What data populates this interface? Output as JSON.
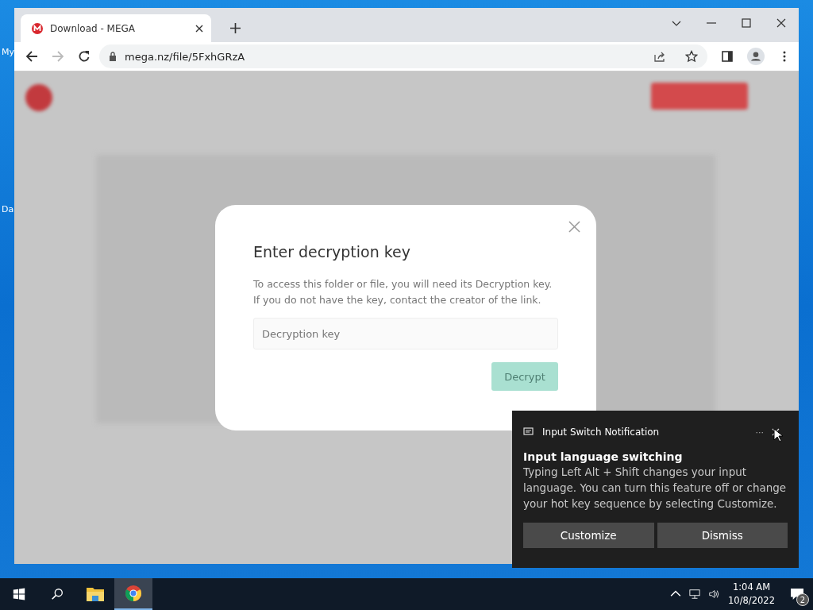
{
  "desktop": {
    "icon_labels": [
      "My",
      "Da"
    ]
  },
  "browser": {
    "tabs": [
      {
        "title": "Download - MEGA",
        "selected": true
      }
    ],
    "address": "mega.nz/file/5FxhGRzA",
    "dialog": {
      "title": "Enter decryption key",
      "lines": [
        "To access this folder or file, you will need its Decryption key.",
        "If you do not have the key, contact the creator of the link."
      ],
      "field": {
        "placeholder": "Decryption key"
      },
      "button": {
        "label": "Decrypt",
        "disabled": true
      }
    }
  },
  "notification": {
    "app": "Input Switch Notification",
    "more": "···",
    "heading": "Input language switching",
    "body": "Typing Left Alt + Shift changes your input language. You can turn this feature off or change your hot key sequence by selecting Customize.",
    "buttons": [
      "Customize",
      "Dismiss"
    ]
  },
  "taskbar": {
    "apps": [
      {
        "kind": "explorer",
        "active": false
      },
      {
        "kind": "chrome",
        "active": true
      }
    ],
    "time": "1:04 AM",
    "date": "10/8/2022",
    "notification_count": "2"
  }
}
